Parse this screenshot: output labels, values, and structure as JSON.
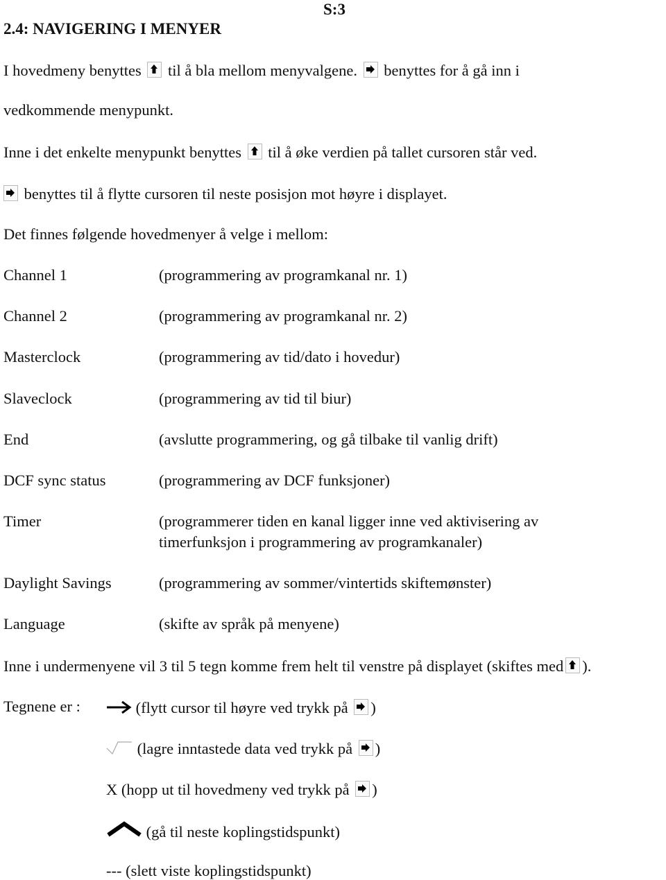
{
  "page_label": "S:3",
  "heading": "2.4: NAVIGERING I MENYER",
  "icons": {
    "up_key": "up-arrow-key-icon",
    "right_key": "right-arrow-key-icon",
    "cursor_right": "arrow-right-icon",
    "save": "checkmark-icon",
    "next": "caret-up-icon"
  },
  "intro": {
    "line1_a": "I hovedmeny benyttes",
    "line1_b": "til å bla mellom menyvalgene.",
    "line1_c": "benyttes for å gå inn i",
    "line2": "vedkommende menypunkt.",
    "line3_a": "Inne i det enkelte menypunkt benyttes",
    "line3_b": "til å øke verdien på tallet cursoren står ved.",
    "line4": "benyttes til å flytte cursoren til neste posisjon mot høyre i displayet.",
    "line5": "Det finnes følgende hovedmenyer å velge i mellom:"
  },
  "menus": [
    {
      "name": "Channel 1",
      "desc": "(programmering av programkanal nr. 1)"
    },
    {
      "name": "Channel 2",
      "desc": "(programmering av programkanal nr. 2)"
    },
    {
      "name": "Masterclock",
      "desc": "(programmering av tid/dato i hovedur)"
    },
    {
      "name": "Slaveclock",
      "desc": "(programmering av tid til biur)"
    },
    {
      "name": "End",
      "desc": "(avslutte programmering, og gå tilbake til vanlig drift)"
    },
    {
      "name": "DCF sync status",
      "desc": "(programmering av DCF funksjoner)"
    },
    {
      "name": "Timer",
      "desc": "(programmerer tiden en kanal ligger inne ved aktivisering av",
      "desc2": "timerfunksjon i programmering av programkanaler)"
    },
    {
      "name": "Daylight Savings",
      "desc": "(programmering av sommer/vintertids skiftemønster)"
    },
    {
      "name": "Language",
      "desc": "(skifte av språk på menyene)"
    }
  ],
  "submenu_note_a": "Inne i undermenyene vil 3 til 5 tegn komme frem helt til venstre på displayet (skiftes med",
  "submenu_note_b": ").",
  "signs_label": "Tegnene er :",
  "signs": {
    "cursor": "(flytt cursor til høyre ved trykk på",
    "save": "(lagre inntastede data ved trykk på",
    "exit_symbol": "X",
    "exit": "(hopp ut til hovedmeny ved trykk på",
    "next": "(gå til neste koplingstidspunkt)",
    "delete_symbol": "---",
    "delete": "(slett viste koplingstidspunkt)",
    "close_paren": ")"
  }
}
